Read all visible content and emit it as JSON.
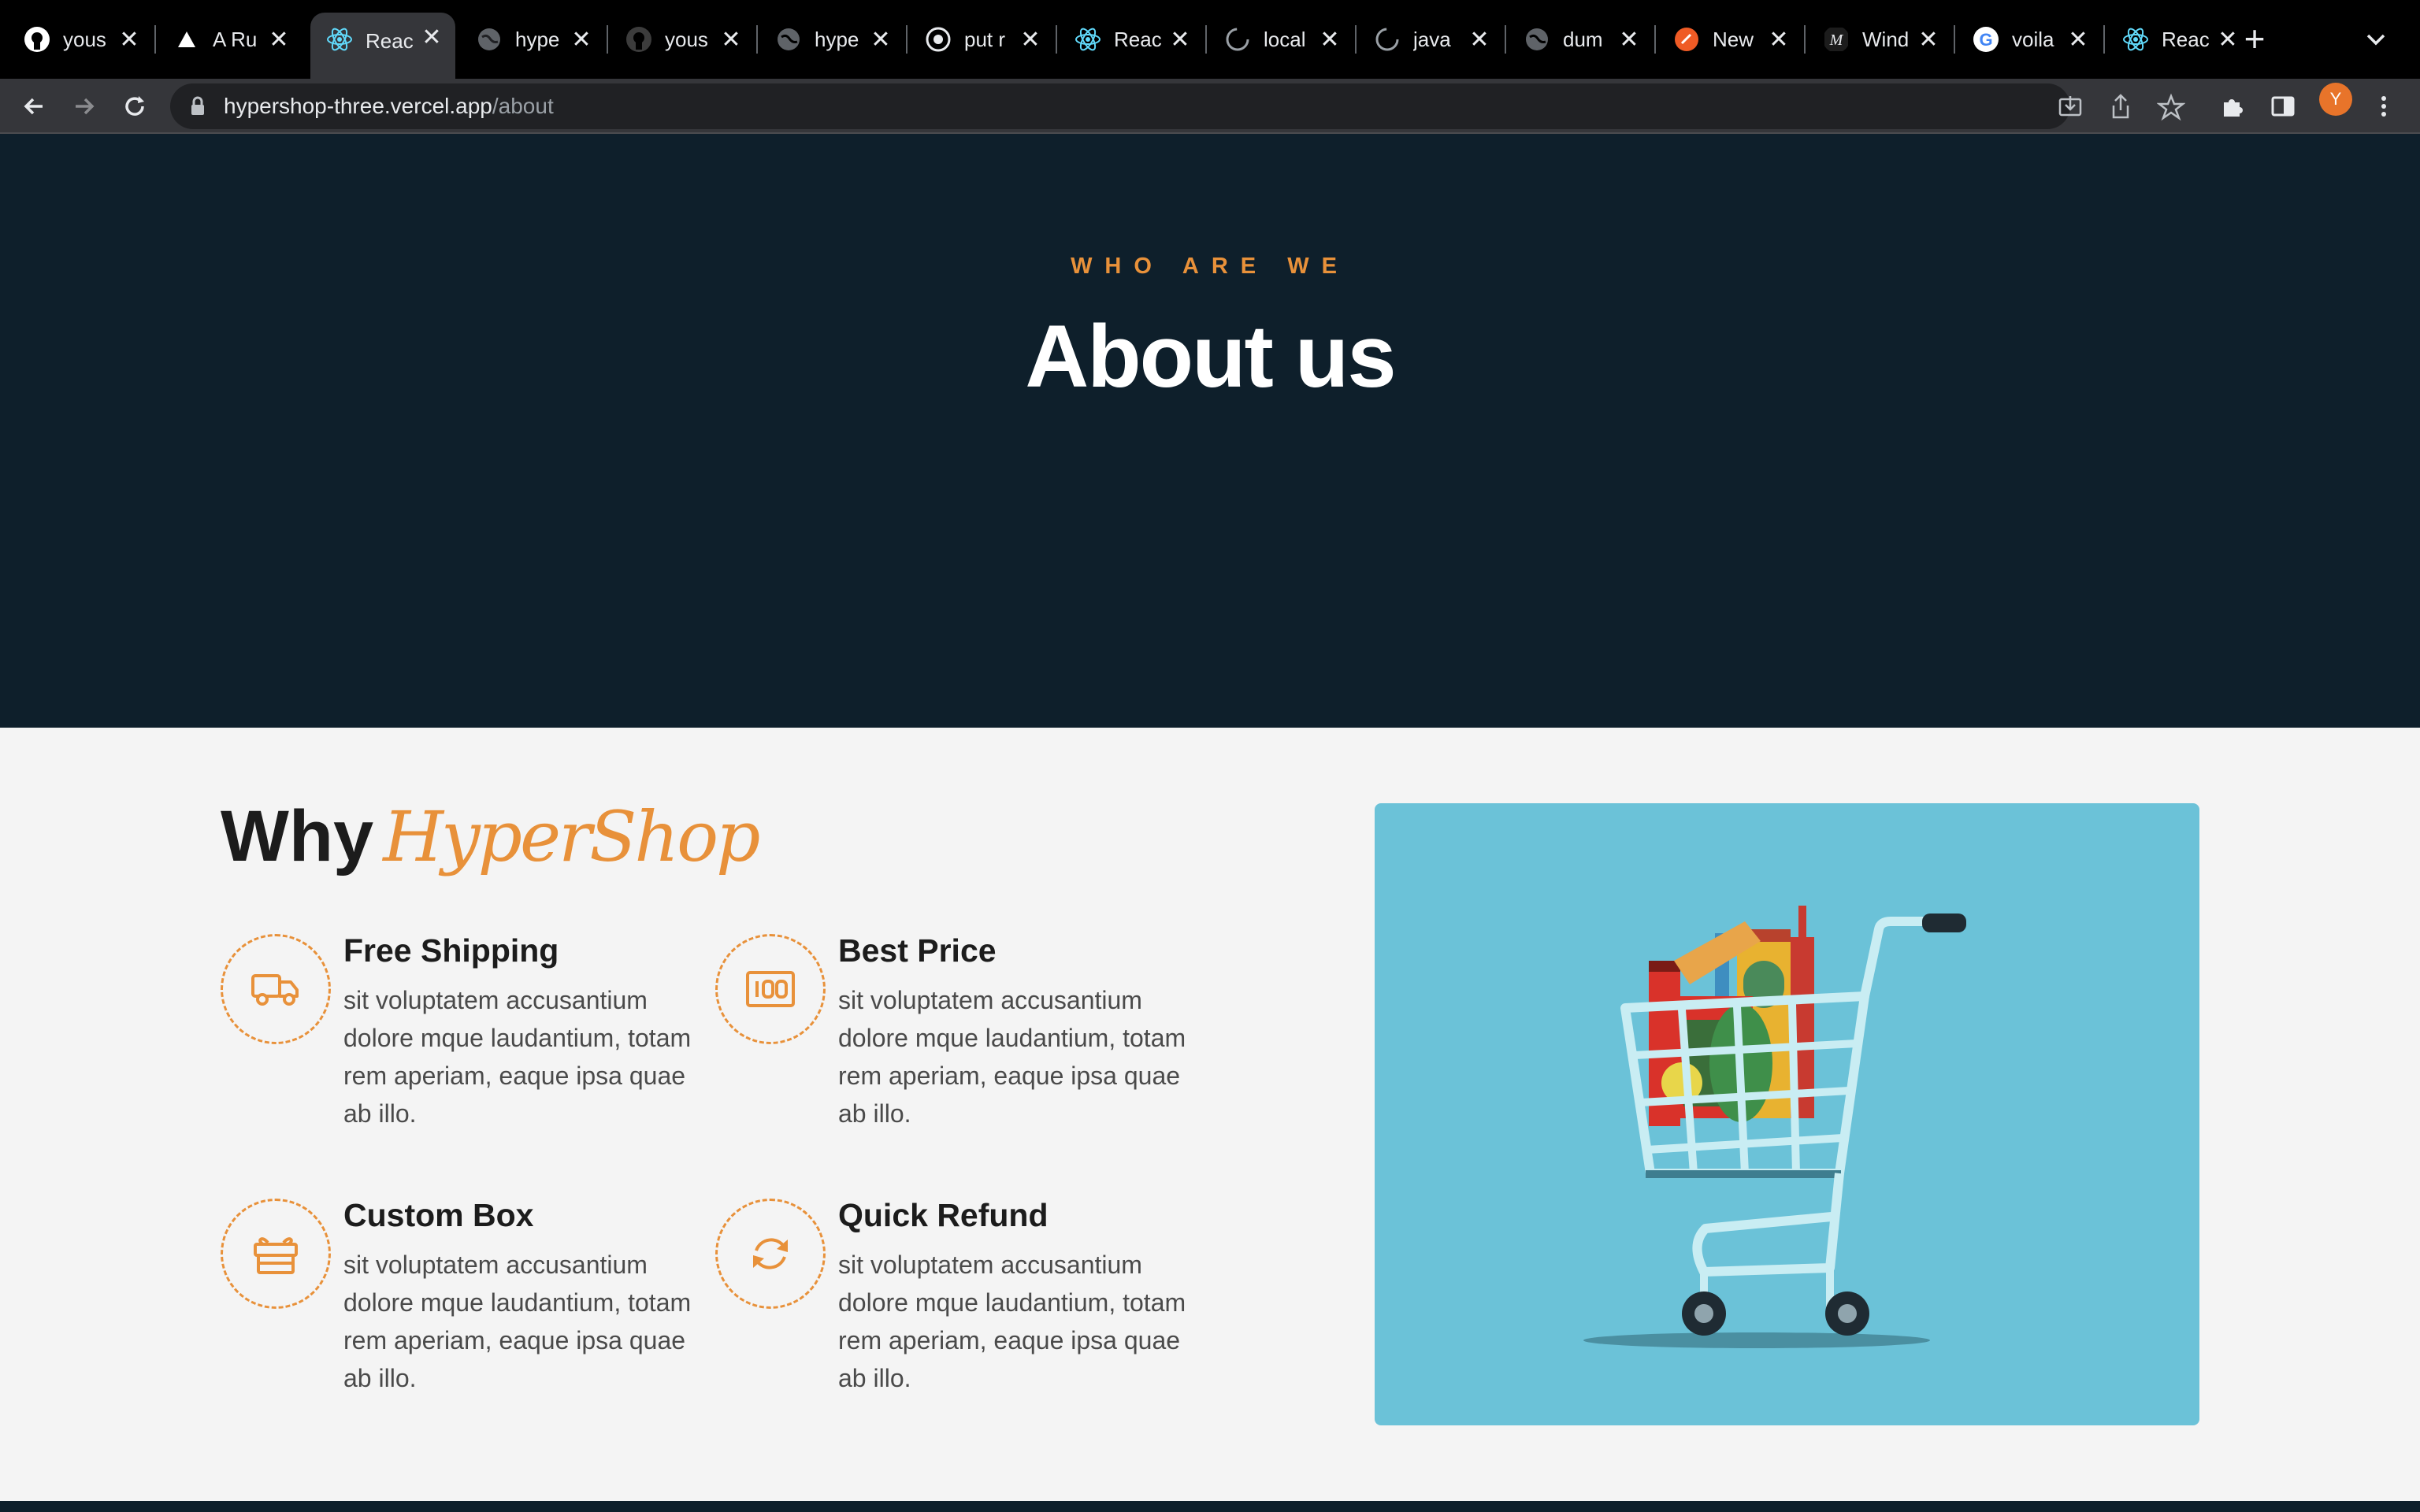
{
  "browser": {
    "tabs": [
      {
        "title": "yous",
        "icon": "github-icon",
        "active": false
      },
      {
        "title": "A Ru",
        "icon": "vercel-icon",
        "active": false
      },
      {
        "title": "Reac",
        "icon": "react-icon",
        "active": true
      },
      {
        "title": "hype",
        "icon": "globe-icon",
        "active": false
      },
      {
        "title": "yous",
        "icon": "github-icon",
        "active": false
      },
      {
        "title": "hype",
        "icon": "globe-icon",
        "active": false
      },
      {
        "title": "put r",
        "icon": "chrome-icon",
        "active": false
      },
      {
        "title": "Reac",
        "icon": "react-icon",
        "active": false
      },
      {
        "title": "local",
        "icon": "loading-icon",
        "active": false
      },
      {
        "title": "java",
        "icon": "loading-icon",
        "active": false
      },
      {
        "title": "dum",
        "icon": "globe-icon",
        "active": false
      },
      {
        "title": "New",
        "icon": "postman-icon",
        "active": false
      },
      {
        "title": "Wind",
        "icon": "medium-icon",
        "active": false
      },
      {
        "title": "voila",
        "icon": "google-icon",
        "active": false
      },
      {
        "title": "Reac",
        "icon": "react-icon",
        "active": false
      }
    ],
    "new_tab_label": "+",
    "close_label": "✕",
    "url": {
      "host": "hypershop-three.vercel.app",
      "path": "/about"
    },
    "avatar_initial": "Y"
  },
  "hero": {
    "eyebrow": "WHO ARE WE",
    "title": "About us"
  },
  "why": {
    "title_prefix": "Why",
    "brand": "HyperShop",
    "features": [
      {
        "title": "Free Shipping",
        "icon": "truck-icon",
        "description": "sit voluptatem accusantium dolore mque laudantium, totam rem aperiam, eaque ipsa quae ab illo."
      },
      {
        "title": "Best Price",
        "icon": "price-tag-100-icon",
        "description": "sit voluptatem accusantium dolore mque laudantium, totam rem aperiam, eaque ipsa quae ab illo."
      },
      {
        "title": "Custom Box",
        "icon": "gift-box-icon",
        "description": "sit voluptatem accusantium dolore mque laudantium, totam rem aperiam, eaque ipsa quae ab illo."
      },
      {
        "title": "Quick Refund",
        "icon": "refresh-icon",
        "description": "sit voluptatem accusantium dolore mque laudantium, totam rem aperiam, eaque ipsa quae ab illo."
      }
    ],
    "illustration": "shopping-cart-with-groceries"
  },
  "colors": {
    "accent": "#e8913a",
    "hero_bg": "#0e1f2b",
    "panel_bg": "#6bc2d8",
    "page_bg": "#f4f4f4"
  }
}
